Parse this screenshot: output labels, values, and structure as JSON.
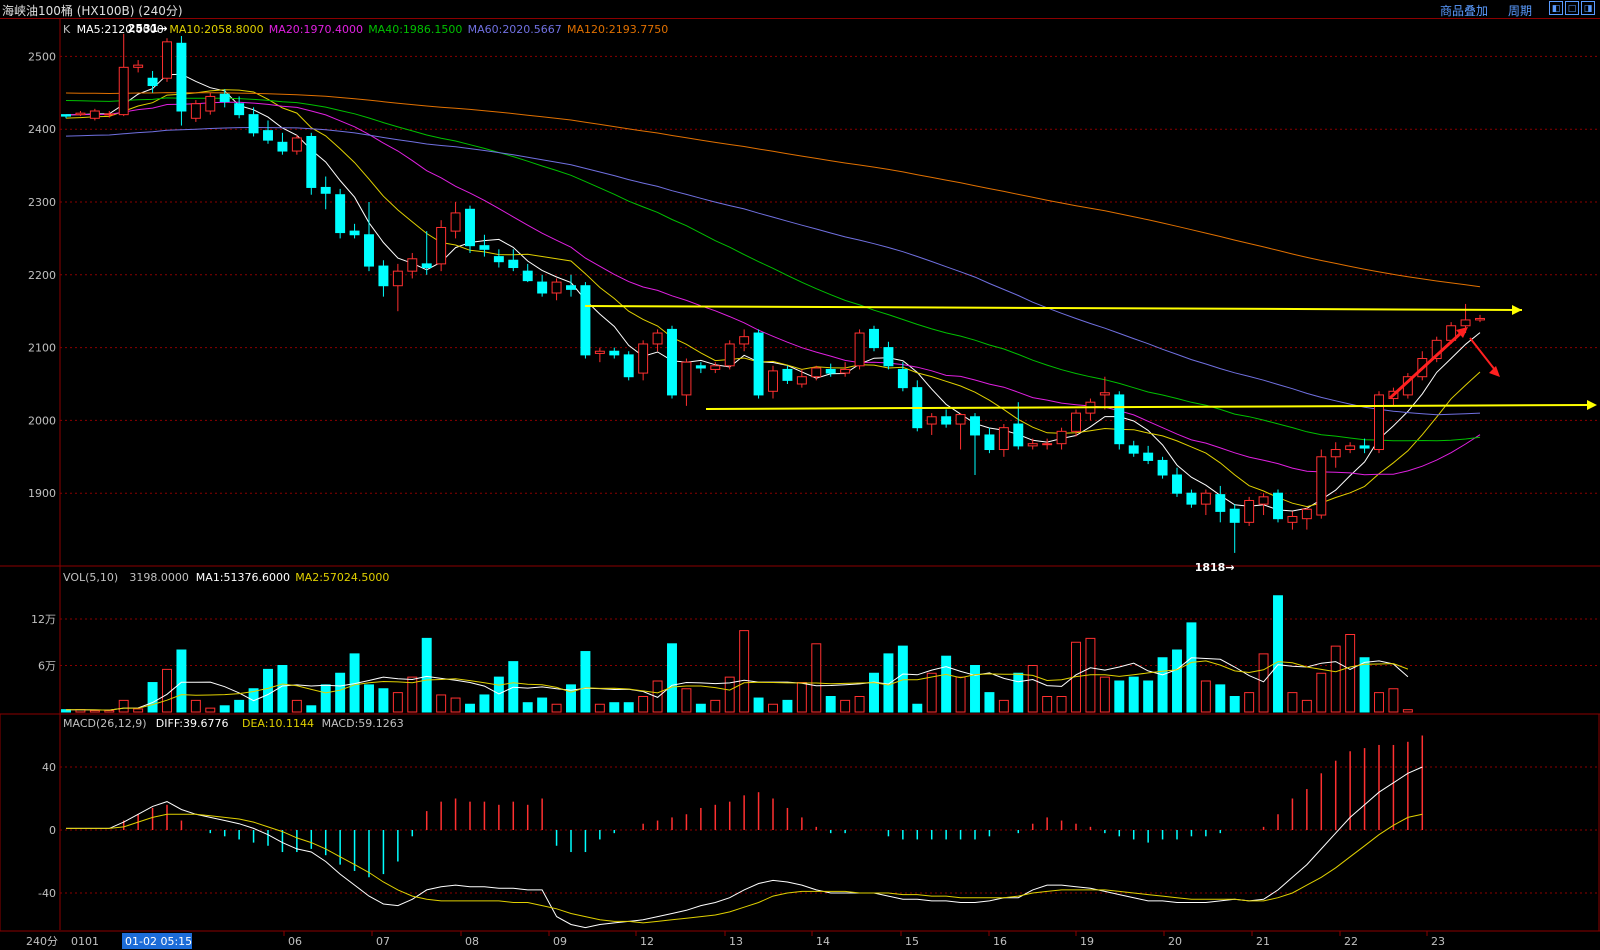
{
  "header": {
    "title": "海峡油100桶 (HX100B) (240分)",
    "links": [
      "商品叠加",
      "周期"
    ],
    "window_buttons": [
      "restore",
      "maximize",
      "close"
    ]
  },
  "price_panel": {
    "legend": [
      {
        "text": "K",
        "color": "#c0c0c0"
      },
      {
        "text": "MA5:2120.0000",
        "color": "#ffffff"
      },
      {
        "text": "MA10:2058.8000",
        "color": "#e0d000"
      },
      {
        "text": "MA20:1970.4000",
        "color": "#e020e0"
      },
      {
        "text": "MA40:1986.1500",
        "color": "#00c000"
      },
      {
        "text": "MA60:2020.5667",
        "color": "#7070e0"
      },
      {
        "text": "MA120:2193.7750",
        "color": "#e07000"
      }
    ],
    "ticks": [
      "2500",
      "2400",
      "2300",
      "2200",
      "2100",
      "2000",
      "1900"
    ],
    "high_label": "2531",
    "low_label": "1818"
  },
  "volume_panel": {
    "legend": [
      {
        "text": "VOL(5,10)",
        "color": "#c0c0c0"
      },
      {
        "text": "3198.0000",
        "color": "#c0c0c0"
      },
      {
        "text": "MA1:51376.6000",
        "color": "#ffffff"
      },
      {
        "text": "MA2:57024.5000",
        "color": "#e0d000"
      }
    ],
    "ticks": [
      "12万",
      "6万"
    ]
  },
  "macd_panel": {
    "legend": [
      {
        "text": "MACD(26,12,9)",
        "color": "#c0c0c0"
      },
      {
        "text": "DIFF:39.6776",
        "color": "#ffffff"
      },
      {
        "text": "DEA:10.1144",
        "color": "#e0d000"
      },
      {
        "text": "MACD:59.1263",
        "color": "#c0c0c0"
      }
    ],
    "ticks": [
      "40",
      "0",
      "-40"
    ]
  },
  "x_axis": {
    "period_label": "240分",
    "first_label": "0101",
    "cursor_label": "01-02 05:15",
    "dates": [
      "06",
      "07",
      "08",
      "09",
      "12",
      "13",
      "14",
      "15",
      "16",
      "19",
      "20",
      "21",
      "22",
      "23"
    ]
  },
  "colors": {
    "up": "#ff3030",
    "down": "#00ffff",
    "grid": "#8b0000",
    "trend": "#ffff00",
    "arrow": "#ff2020"
  },
  "chart_data": {
    "type": "candlestick",
    "ylim": [
      1800,
      2550
    ],
    "annotations": [
      "2531",
      "1818"
    ],
    "candles": [
      {
        "o": 2420,
        "h": 2420,
        "l": 2415,
        "c": 2418
      },
      {
        "o": 2420,
        "h": 2425,
        "l": 2418,
        "c": 2422
      },
      {
        "o": 2415,
        "h": 2428,
        "l": 2412,
        "c": 2425
      },
      {
        "o": 2420,
        "h": 2425,
        "l": 2416,
        "c": 2421
      },
      {
        "o": 2420,
        "h": 2531,
        "l": 2418,
        "c": 2485
      },
      {
        "o": 2485,
        "h": 2495,
        "l": 2478,
        "c": 2488
      },
      {
        "o": 2470,
        "h": 2480,
        "l": 2450,
        "c": 2460
      },
      {
        "o": 2470,
        "h": 2525,
        "l": 2465,
        "c": 2520
      },
      {
        "o": 2518,
        "h": 2528,
        "l": 2405,
        "c": 2425
      },
      {
        "o": 2415,
        "h": 2440,
        "l": 2410,
        "c": 2435
      },
      {
        "o": 2425,
        "h": 2450,
        "l": 2420,
        "c": 2445
      },
      {
        "o": 2448,
        "h": 2455,
        "l": 2430,
        "c": 2438
      },
      {
        "o": 2435,
        "h": 2445,
        "l": 2415,
        "c": 2420
      },
      {
        "o": 2420,
        "h": 2430,
        "l": 2390,
        "c": 2395
      },
      {
        "o": 2398,
        "h": 2412,
        "l": 2380,
        "c": 2385
      },
      {
        "o": 2382,
        "h": 2395,
        "l": 2365,
        "c": 2370
      },
      {
        "o": 2370,
        "h": 2392,
        "l": 2365,
        "c": 2388
      },
      {
        "o": 2390,
        "h": 2395,
        "l": 2310,
        "c": 2320
      },
      {
        "o": 2320,
        "h": 2335,
        "l": 2290,
        "c": 2312
      },
      {
        "o": 2310,
        "h": 2318,
        "l": 2250,
        "c": 2258
      },
      {
        "o": 2260,
        "h": 2270,
        "l": 2250,
        "c": 2255
      },
      {
        "o": 2255,
        "h": 2300,
        "l": 2205,
        "c": 2212
      },
      {
        "o": 2212,
        "h": 2220,
        "l": 2170,
        "c": 2185
      },
      {
        "o": 2185,
        "h": 2215,
        "l": 2150,
        "c": 2205
      },
      {
        "o": 2205,
        "h": 2230,
        "l": 2195,
        "c": 2222
      },
      {
        "o": 2215,
        "h": 2260,
        "l": 2200,
        "c": 2210
      },
      {
        "o": 2215,
        "h": 2275,
        "l": 2205,
        "c": 2265
      },
      {
        "o": 2260,
        "h": 2300,
        "l": 2250,
        "c": 2285
      },
      {
        "o": 2290,
        "h": 2295,
        "l": 2230,
        "c": 2240
      },
      {
        "o": 2240,
        "h": 2255,
        "l": 2225,
        "c": 2235
      },
      {
        "o": 2225,
        "h": 2235,
        "l": 2210,
        "c": 2218
      },
      {
        "o": 2220,
        "h": 2235,
        "l": 2205,
        "c": 2210
      },
      {
        "o": 2205,
        "h": 2215,
        "l": 2190,
        "c": 2192
      },
      {
        "o": 2190,
        "h": 2200,
        "l": 2170,
        "c": 2175
      },
      {
        "o": 2175,
        "h": 2195,
        "l": 2165,
        "c": 2190
      },
      {
        "o": 2185,
        "h": 2200,
        "l": 2170,
        "c": 2180
      },
      {
        "o": 2185,
        "h": 2190,
        "l": 2085,
        "c": 2090
      },
      {
        "o": 2092,
        "h": 2100,
        "l": 2080,
        "c": 2095
      },
      {
        "o": 2095,
        "h": 2100,
        "l": 2085,
        "c": 2090
      },
      {
        "o": 2090,
        "h": 2095,
        "l": 2055,
        "c": 2060
      },
      {
        "o": 2065,
        "h": 2110,
        "l": 2055,
        "c": 2105
      },
      {
        "o": 2105,
        "h": 2125,
        "l": 2095,
        "c": 2120
      },
      {
        "o": 2125,
        "h": 2130,
        "l": 2030,
        "c": 2035
      },
      {
        "o": 2035,
        "h": 2085,
        "l": 2020,
        "c": 2080
      },
      {
        "o": 2075,
        "h": 2080,
        "l": 2065,
        "c": 2072
      },
      {
        "o": 2070,
        "h": 2080,
        "l": 2065,
        "c": 2075
      },
      {
        "o": 2075,
        "h": 2110,
        "l": 2070,
        "c": 2105
      },
      {
        "o": 2105,
        "h": 2125,
        "l": 2095,
        "c": 2115
      },
      {
        "o": 2120,
        "h": 2125,
        "l": 2030,
        "c": 2035
      },
      {
        "o": 2040,
        "h": 2075,
        "l": 2030,
        "c": 2068
      },
      {
        "o": 2070,
        "h": 2075,
        "l": 2050,
        "c": 2055
      },
      {
        "o": 2050,
        "h": 2070,
        "l": 2045,
        "c": 2060
      },
      {
        "o": 2060,
        "h": 2075,
        "l": 2055,
        "c": 2072
      },
      {
        "o": 2070,
        "h": 2078,
        "l": 2060,
        "c": 2065
      },
      {
        "o": 2065,
        "h": 2080,
        "l": 2060,
        "c": 2070
      },
      {
        "o": 2075,
        "h": 2125,
        "l": 2070,
        "c": 2120
      },
      {
        "o": 2125,
        "h": 2130,
        "l": 2095,
        "c": 2100
      },
      {
        "o": 2100,
        "h": 2108,
        "l": 2070,
        "c": 2075
      },
      {
        "o": 2070,
        "h": 2080,
        "l": 2040,
        "c": 2045
      },
      {
        "o": 2045,
        "h": 2055,
        "l": 1985,
        "c": 1990
      },
      {
        "o": 1995,
        "h": 2010,
        "l": 1980,
        "c": 2005
      },
      {
        "o": 2005,
        "h": 2015,
        "l": 1990,
        "c": 1995
      },
      {
        "o": 1995,
        "h": 2010,
        "l": 1960,
        "c": 2008
      },
      {
        "o": 2005,
        "h": 2010,
        "l": 1925,
        "c": 1980
      },
      {
        "o": 1980,
        "h": 1990,
        "l": 1955,
        "c": 1960
      },
      {
        "o": 1960,
        "h": 1995,
        "l": 1950,
        "c": 1990
      },
      {
        "o": 1995,
        "h": 2025,
        "l": 1960,
        "c": 1965
      },
      {
        "o": 1965,
        "h": 1975,
        "l": 1960,
        "c": 1968
      },
      {
        "o": 1968,
        "h": 1975,
        "l": 1960,
        "c": 1968
      },
      {
        "o": 1968,
        "h": 1990,
        "l": 1960,
        "c": 1985
      },
      {
        "o": 1985,
        "h": 2015,
        "l": 1978,
        "c": 2010
      },
      {
        "o": 2010,
        "h": 2030,
        "l": 2000,
        "c": 2025
      },
      {
        "o": 2035,
        "h": 2060,
        "l": 2015,
        "c": 2038
      },
      {
        "o": 2035,
        "h": 2040,
        "l": 1960,
        "c": 1968
      },
      {
        "o": 1965,
        "h": 1972,
        "l": 1950,
        "c": 1955
      },
      {
        "o": 1955,
        "h": 1965,
        "l": 1940,
        "c": 1945
      },
      {
        "o": 1945,
        "h": 1950,
        "l": 1920,
        "c": 1925
      },
      {
        "o": 1925,
        "h": 1935,
        "l": 1895,
        "c": 1900
      },
      {
        "o": 1900,
        "h": 1905,
        "l": 1880,
        "c": 1885
      },
      {
        "o": 1885,
        "h": 1905,
        "l": 1870,
        "c": 1900
      },
      {
        "o": 1898,
        "h": 1910,
        "l": 1860,
        "c": 1875
      },
      {
        "o": 1878,
        "h": 1885,
        "l": 1818,
        "c": 1860
      },
      {
        "o": 1860,
        "h": 1895,
        "l": 1855,
        "c": 1890
      },
      {
        "o": 1885,
        "h": 1900,
        "l": 1870,
        "c": 1895
      },
      {
        "o": 1900,
        "h": 1905,
        "l": 1860,
        "c": 1865
      },
      {
        "o": 1860,
        "h": 1875,
        "l": 1850,
        "c": 1868
      },
      {
        "o": 1865,
        "h": 1880,
        "l": 1850,
        "c": 1878
      },
      {
        "o": 1870,
        "h": 1960,
        "l": 1865,
        "c": 1950
      },
      {
        "o": 1950,
        "h": 1970,
        "l": 1935,
        "c": 1960
      },
      {
        "o": 1960,
        "h": 1970,
        "l": 1955,
        "c": 1965
      },
      {
        "o": 1965,
        "h": 1975,
        "l": 1955,
        "c": 1962
      },
      {
        "o": 1960,
        "h": 2040,
        "l": 1955,
        "c": 2035
      },
      {
        "o": 2030,
        "h": 2045,
        "l": 2020,
        "c": 2040
      },
      {
        "o": 2035,
        "h": 2065,
        "l": 2030,
        "c": 2060
      },
      {
        "o": 2060,
        "h": 2095,
        "l": 2055,
        "c": 2085
      },
      {
        "o": 2085,
        "h": 2115,
        "l": 2080,
        "c": 2110
      },
      {
        "o": 2110,
        "h": 2135,
        "l": 2105,
        "c": 2130
      },
      {
        "o": 2130,
        "h": 2160,
        "l": 2120,
        "c": 2138
      },
      {
        "o": 2138,
        "h": 2145,
        "l": 2135,
        "c": 2140
      }
    ],
    "volume_thousands": [
      3,
      3,
      2,
      2,
      15,
      4,
      38,
      55,
      80,
      15,
      5,
      8,
      15,
      30,
      55,
      60,
      15,
      8,
      35,
      50,
      75,
      35,
      30,
      25,
      45,
      95,
      22,
      18,
      10,
      22,
      45,
      65,
      12,
      18,
      10,
      35,
      78,
      10,
      12,
      12,
      20,
      40,
      88,
      30,
      10,
      15,
      45,
      105,
      18,
      10,
      15,
      38,
      88,
      20,
      15,
      20,
      50,
      75,
      85,
      10,
      50,
      72,
      45,
      60,
      25,
      15,
      50,
      60,
      20,
      20,
      90,
      95,
      45,
      40,
      45,
      40,
      70,
      80,
      115,
      40,
      35,
      20,
      25,
      75,
      150,
      25,
      15,
      50,
      85,
      100,
      70,
      25,
      30,
      3
    ],
    "diff": [
      1,
      1,
      1,
      1,
      5,
      10,
      15,
      18,
      13,
      10,
      8,
      6,
      4,
      1,
      -3,
      -8,
      -12,
      -14,
      -20,
      -28,
      -35,
      -42,
      -47,
      -48,
      -44,
      -38,
      -36,
      -35,
      -36,
      -36,
      -37,
      -37,
      -38,
      -38,
      -55,
      -60,
      -62,
      -60,
      -59,
      -58,
      -57,
      -55,
      -53,
      -51,
      -48,
      -46,
      -43,
      -38,
      -34,
      -32,
      -33,
      -35,
      -38,
      -40,
      -40,
      -40,
      -40,
      -42,
      -44,
      -44,
      -45,
      -45,
      -46,
      -46,
      -45,
      -43,
      -43,
      -38,
      -35,
      -35,
      -36,
      -37,
      -39,
      -41,
      -43,
      -45,
      -45,
      -46,
      -46,
      -46,
      -45,
      -44,
      -45,
      -44,
      -38,
      -30,
      -22,
      -12,
      -2,
      8,
      16,
      24,
      30,
      36,
      40
    ],
    "dea": [
      1,
      1,
      1,
      1,
      2,
      5,
      8,
      10,
      10,
      10,
      9,
      8,
      7,
      5,
      2,
      -1,
      -5,
      -8,
      -12,
      -17,
      -22,
      -27,
      -33,
      -38,
      -42,
      -44,
      -45,
      -45,
      -45,
      -45,
      -45,
      -46,
      -46,
      -48,
      -50,
      -53,
      -55,
      -57,
      -58,
      -58,
      -59,
      -58,
      -57,
      -56,
      -55,
      -54,
      -52,
      -49,
      -46,
      -42,
      -40,
      -39,
      -39,
      -39,
      -39,
      -40,
      -40,
      -40,
      -41,
      -41,
      -42,
      -42,
      -43,
      -43,
      -43,
      -43,
      -42,
      -40,
      -39,
      -38,
      -38,
      -38,
      -38,
      -39,
      -40,
      -41,
      -42,
      -43,
      -44,
      -44,
      -44,
      -44,
      -45,
      -45,
      -43,
      -40,
      -35,
      -30,
      -24,
      -17,
      -10,
      -3,
      3,
      8,
      10
    ]
  }
}
